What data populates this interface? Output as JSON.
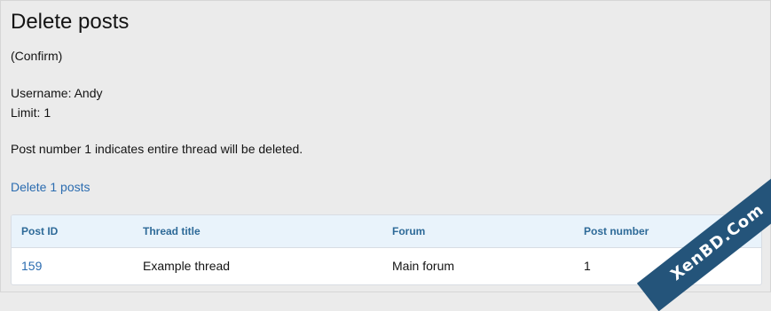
{
  "page": {
    "title": "Delete posts",
    "confirm_text": "(Confirm)",
    "username_line": "Username: Andy",
    "limit_line": "Limit: 1",
    "note": "Post number 1 indicates entire thread will be deleted.",
    "delete_link": "Delete 1 posts"
  },
  "table": {
    "columns": [
      "Post ID",
      "Thread title",
      "Forum",
      "Post number"
    ],
    "rows": [
      [
        "159",
        "Example thread",
        "Main forum",
        "1"
      ]
    ]
  },
  "watermark": "XenBD.Com"
}
